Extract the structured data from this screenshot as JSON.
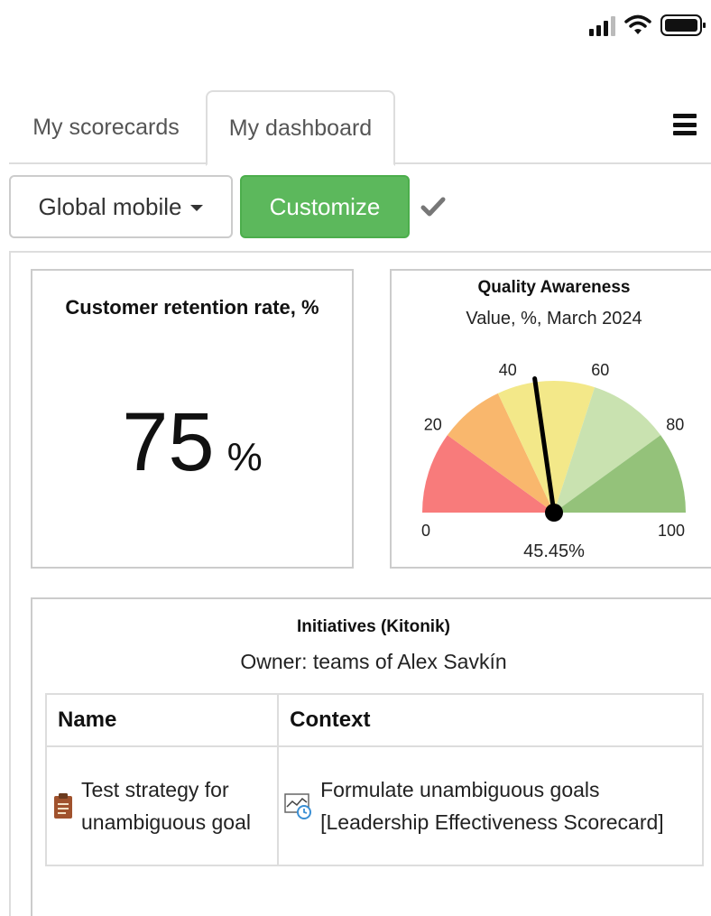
{
  "status_bar": {
    "icons": [
      "signal-icon",
      "wifi-icon",
      "battery-icon"
    ]
  },
  "tabs": [
    {
      "label": "My scorecards",
      "active": false
    },
    {
      "label": "My dashboard",
      "active": true
    }
  ],
  "toolbar": {
    "dashboard_select": "Global mobile",
    "customize_label": "Customize",
    "colors": {
      "customize": "#5cb85c"
    }
  },
  "kpi_card": {
    "title": "Customer retention rate, %",
    "value": "75",
    "unit": "%"
  },
  "gauge_card": {
    "title": "Quality Awareness",
    "subtitle": "Value, %, March 2024",
    "value_label": "45.45%",
    "value": 45.45,
    "min": 0,
    "max": 100,
    "ticks": [
      "0",
      "20",
      "40",
      "60",
      "80",
      "100"
    ],
    "bands": [
      {
        "from": 0,
        "to": 20,
        "color": "#f87b7b"
      },
      {
        "from": 20,
        "to": 36,
        "color": "#f9b76d"
      },
      {
        "from": 36,
        "to": 60,
        "color": "#f3e889"
      },
      {
        "from": 60,
        "to": 80,
        "color": "#c9e2b0"
      },
      {
        "from": 80,
        "to": 100,
        "color": "#94c27a"
      }
    ]
  },
  "initiatives": {
    "title": "Initiatives (Kitonik)",
    "owner": "Owner: teams of Alex Savkín",
    "columns": [
      "Name",
      "Context"
    ],
    "rows": [
      {
        "name": "Test strategy for unambiguous goal",
        "name_icon": "clipboard-icon",
        "context": "Formulate unambiguous goals [Leadership Effectiveness Scorecard]",
        "context_icon": "scorecard-chart-icon"
      }
    ]
  }
}
